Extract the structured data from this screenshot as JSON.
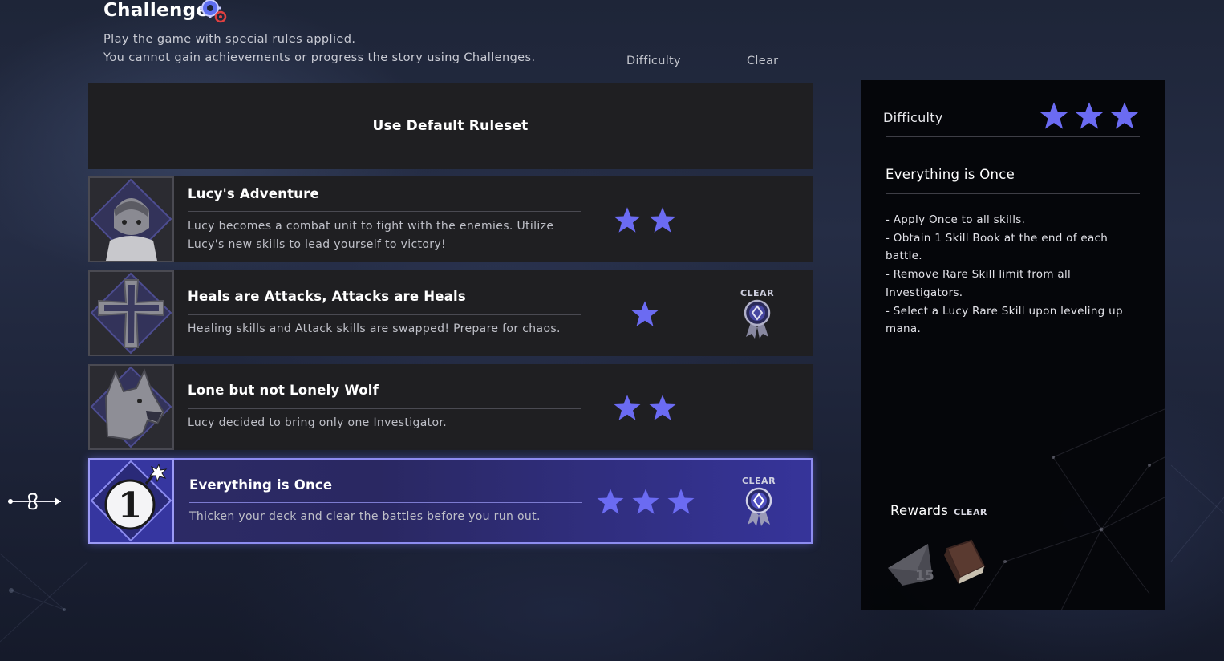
{
  "header": {
    "title": "Challenge",
    "subtitle_line1": "Play the game with special rules applied.",
    "subtitle_line2": "You cannot gain achievements or progress the story using Challenges."
  },
  "columns": {
    "difficulty": "Difficulty",
    "clear": "Clear"
  },
  "default_ruleset_label": "Use Default Ruleset",
  "challenges": [
    {
      "title": "Lucy's Adventure",
      "desc_line1": "Lucy becomes a combat unit to fight with the enemies. Utilize",
      "desc_line2": "Lucy's new skills to lead yourself to victory!",
      "difficulty": 2,
      "cleared": false,
      "icon": "lucy-portrait-icon"
    },
    {
      "title": "Heals are Attacks, Attacks are Heals",
      "desc_line1": "Healing skills and Attack skills are swapped! Prepare for chaos.",
      "difficulty": 1,
      "cleared": true,
      "clear_label": "CLEAR",
      "icon": "cross-icon"
    },
    {
      "title": "Lone but not Lonely Wolf",
      "desc_line1": "Lucy decided to bring only one Investigator.",
      "difficulty": 2,
      "cleared": false,
      "icon": "wolf-icon"
    },
    {
      "title": "Everything is Once",
      "desc_line1": "Thicken your deck and clear the battles before you run out.",
      "difficulty": 3,
      "cleared": true,
      "clear_label": "CLEAR",
      "selected": true,
      "icon": "bomb-one-icon"
    }
  ],
  "detail": {
    "difficulty_label": "Difficulty",
    "difficulty": 3,
    "title": "Everything is Once",
    "rules": [
      "- Apply Once to all skills.",
      "- Obtain 1 Skill Book at the end of each",
      "battle.",
      "- Remove Rare Skill limit from all",
      "Investigators.",
      "- Select a Lucy Rare Skill upon leveling up",
      "mana."
    ],
    "rewards_label": "Rewards",
    "rewards_clear": "CLEAR",
    "reward_quantity": "15"
  },
  "colors": {
    "star": "#6b6bf2",
    "selected_border": "#8d8cf0",
    "row_bg": "#1f1f22"
  }
}
